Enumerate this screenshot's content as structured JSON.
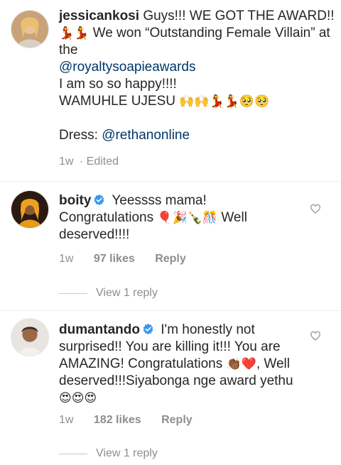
{
  "caption": {
    "username": "jessicankosi",
    "text_a": "Guys!!! WE GOT THE AWARD!!",
    "emoji_a": "💃💃",
    "text_b": "We won “Outstanding Female Villain” at the",
    "mention_award": "@royaltysoapieawards",
    "text_c": "I am so so happy!!!!",
    "text_d": "WAMUHLE UJESU",
    "emoji_d": "🙌🙌💃💃🥺🥺",
    "dress_label": "Dress:",
    "mention_dress": "@rethanonline",
    "time": "1w",
    "edited": "· Edited"
  },
  "comments": [
    {
      "username": "boity",
      "text_a": "Yeessss mama! Congratulations",
      "emoji_a": "🎈🎉🍾🎊",
      "text_b": "Well deserved!!!!",
      "time": "1w",
      "likes": "97 likes",
      "reply": "Reply",
      "view_replies": "View 1 reply"
    },
    {
      "username": "dumantando",
      "text_a": "I'm honestly not surprised!! You are killing it!!! You are AMAZING! Congratulations",
      "emoji_a": "👏🏾❤️",
      "text_b": ", Well deserved!!!Siyabonga nge award yethu",
      "emoji_b": "😍😍😍",
      "time": "1w",
      "likes": "182 likes",
      "reply": "Reply",
      "view_replies": "View 1 reply"
    }
  ],
  "icons": {
    "heart": "heart-outline-icon",
    "verified": "verified-badge-icon"
  },
  "colors": {
    "text": "#262626",
    "secondary": "#8e8e8e",
    "mention": "#00376b",
    "verified": "#3897f0"
  }
}
